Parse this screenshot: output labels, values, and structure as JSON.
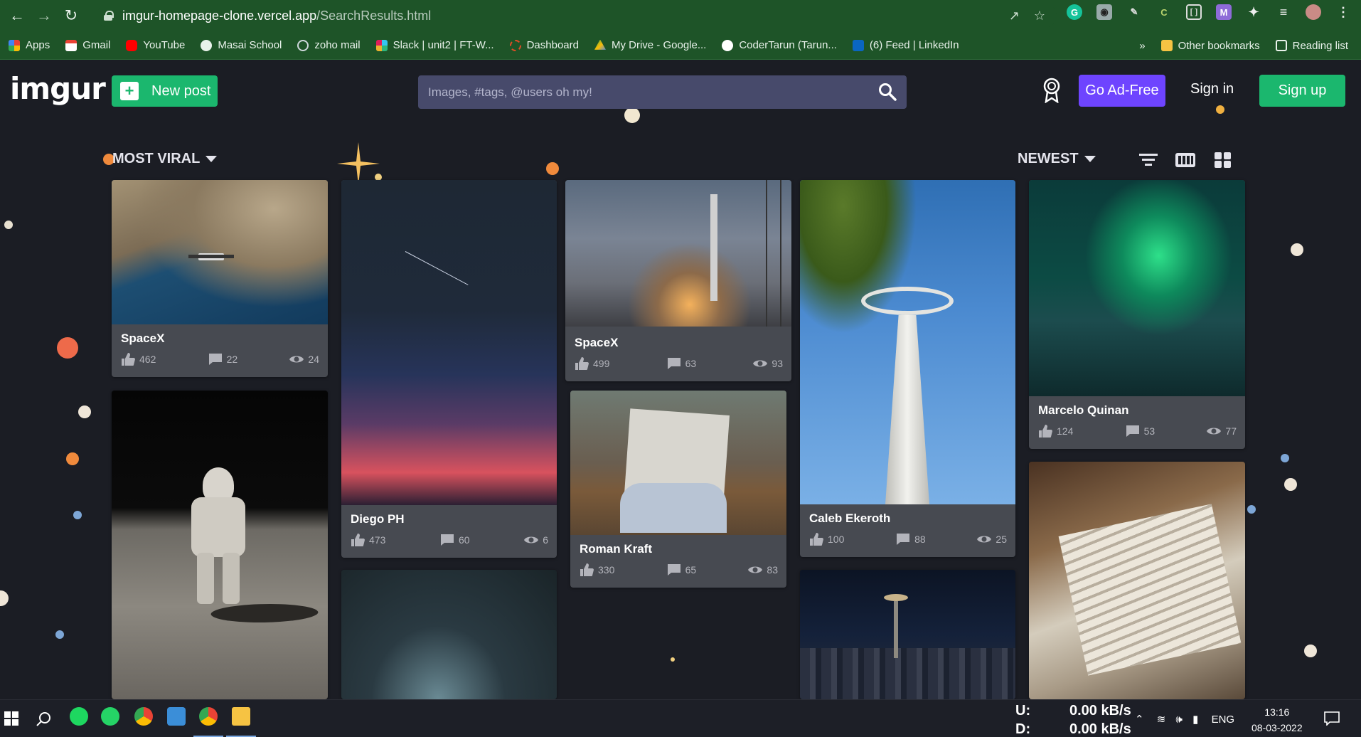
{
  "browser": {
    "url_host": "imgur-homepage-clone.vercel.app",
    "url_path": "/SearchResults.html",
    "bookmarks": [
      {
        "label": "Apps",
        "color": "#e94235"
      },
      {
        "label": "Gmail",
        "color": "#ea4335"
      },
      {
        "label": "YouTube",
        "color": "#ff0000"
      },
      {
        "label": "Masai School",
        "color": "#ffffff"
      },
      {
        "label": "zoho mail",
        "color": "#cfd8dc"
      },
      {
        "label": "Slack | unit2 | FT-W...",
        "color": "#36c5f0"
      },
      {
        "label": "Dashboard",
        "color": "#e44d26"
      },
      {
        "label": "My Drive - Google...",
        "color": "#fbbc04"
      },
      {
        "label": "CoderTarun (Tarun...",
        "color": "#ffffff"
      },
      {
        "label": "(6) Feed | LinkedIn",
        "color": "#0a66c2"
      }
    ],
    "bookmarks_more": "»",
    "other_bookmarks": "Other bookmarks",
    "reading_list": "Reading list"
  },
  "header": {
    "logo": "imgur",
    "new_post": "New post",
    "search_placeholder": "Images, #tags, @users oh my!",
    "go_ad_free": "Go Ad-Free",
    "sign_in": "Sign in",
    "sign_up": "Sign up"
  },
  "sort": {
    "left": "MOST VIRAL",
    "right": "NEWEST"
  },
  "cards": [
    {
      "title": "SpaceX",
      "upvotes": "462",
      "comments": "22",
      "views": "24"
    },
    {
      "title": "",
      "upvotes": "",
      "comments": "",
      "views": ""
    },
    {
      "title": "Diego PH",
      "upvotes": "473",
      "comments": "60",
      "views": "6"
    },
    {
      "title": "",
      "upvotes": "",
      "comments": "",
      "views": ""
    },
    {
      "title": "SpaceX",
      "upvotes": "499",
      "comments": "63",
      "views": "93"
    },
    {
      "title": "Roman Kraft",
      "upvotes": "330",
      "comments": "65",
      "views": "83"
    },
    {
      "title": "Caleb Ekeroth",
      "upvotes": "100",
      "comments": "88",
      "views": "25"
    },
    {
      "title": "",
      "upvotes": "",
      "comments": "",
      "views": ""
    },
    {
      "title": "Marcelo Quinan",
      "upvotes": "124",
      "comments": "53",
      "views": "77"
    },
    {
      "title": "",
      "upvotes": "",
      "comments": "",
      "views": ""
    }
  ],
  "taskbar": {
    "net_up_label": "U:",
    "net_down_label": "D:",
    "net_up": "0.00 kB/s",
    "net_down": "0.00 kB/s",
    "lang": "ENG",
    "time": "13:16",
    "date": "08-03-2022"
  }
}
